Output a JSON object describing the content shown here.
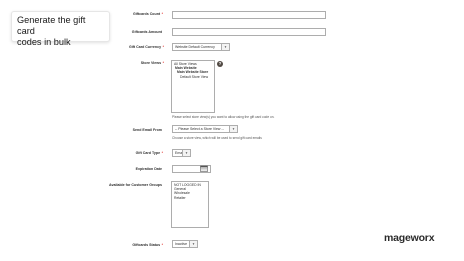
{
  "callout": {
    "line1": "Generate the gift card",
    "line2": "codes in bulk"
  },
  "form": {
    "giftcards_count_label": "Giftcards Count",
    "giftcards_amount_label": "Giftcards Amount",
    "currency_label": "Gift Card Currency",
    "currency_value": "Website Default Currency",
    "store_views_label": "Store Views",
    "store_views_options": [
      "All Store Views",
      "Main Website",
      "Main Website Store",
      "Default Store View"
    ],
    "store_views_note": "Please select store view(s) you want to allow using the gift card code on.",
    "send_email_label": "Send Email From",
    "send_email_value": "-- Please Select a Store View --",
    "send_email_note": "Choose a store view, which will be used to send gift card emails",
    "card_type_label": "Gift Card Type",
    "card_type_value": "Email",
    "expiration_label": "Expiration Date",
    "customer_groups_label": "Available for Customer Groups",
    "customer_groups_options": [
      "NOT LOGGED IN",
      "General",
      "Wholesale",
      "Retailer"
    ],
    "status_label": "Giftcards Status",
    "status_value": "Inactive",
    "required_mark": "*"
  },
  "help_icon_glyph": "?",
  "brand": "mageworx"
}
